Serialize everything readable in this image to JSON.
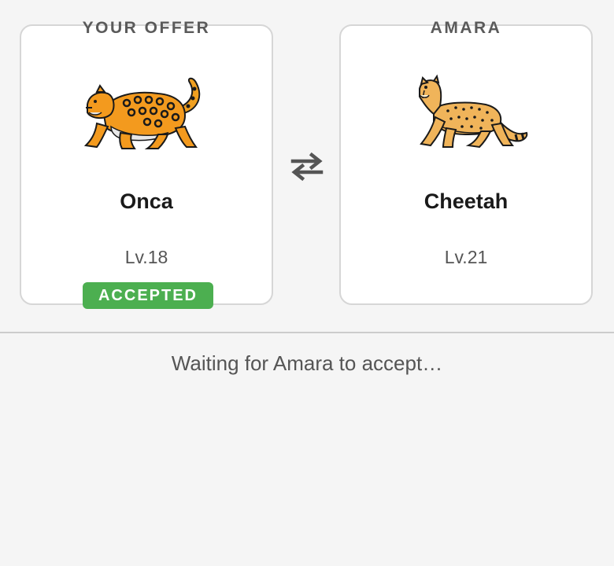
{
  "offer": {
    "header": "YOUR OFFER",
    "creature_icon": "jaguar-sprite",
    "name": "Onca",
    "level": "Lv.18",
    "status_badge": "ACCEPTED"
  },
  "partner": {
    "header": "AMARA",
    "creature_icon": "cheetah-sprite",
    "name": "Cheetah",
    "level": "Lv.21"
  },
  "swap_icon": "swap-arrows-icon",
  "status_message": "Waiting for Amara to accept…",
  "colors": {
    "background": "#f5f5f5",
    "card": "#ffffff",
    "card_border": "#d6d6d6",
    "accepted": "#4caf50",
    "text_dark": "#1a1a1a",
    "text_muted": "#555555"
  }
}
